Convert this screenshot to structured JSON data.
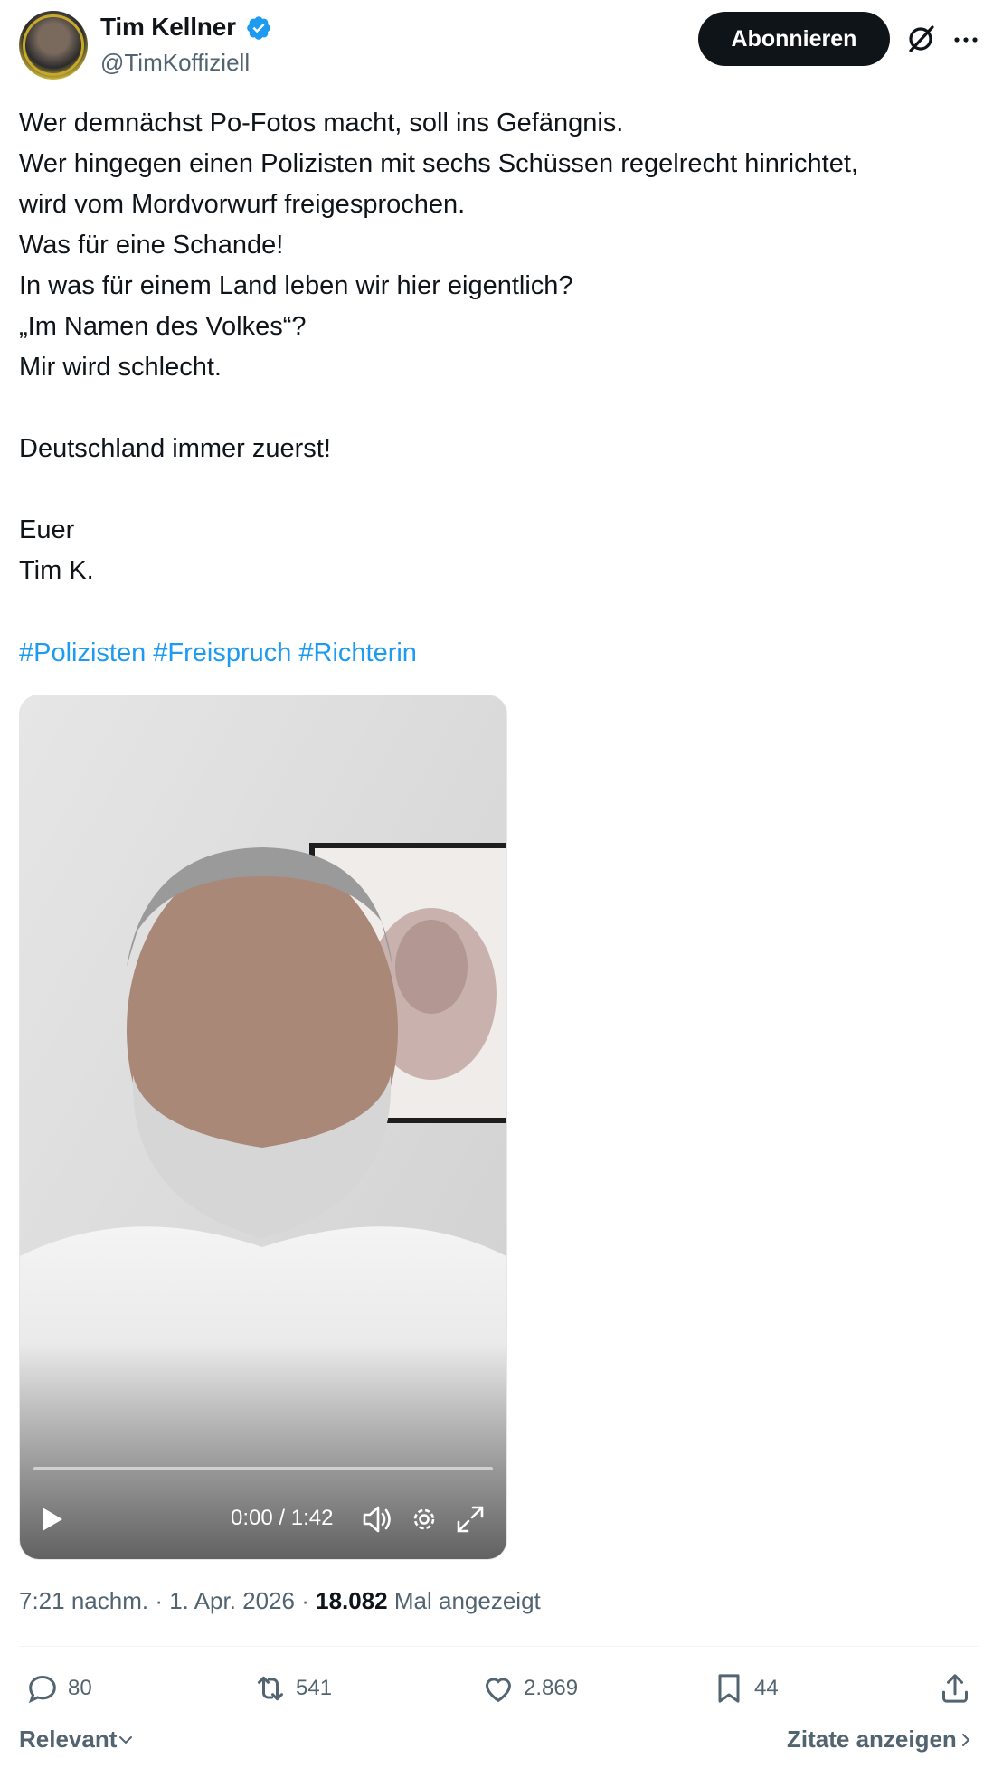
{
  "author": {
    "display_name": "Tim Kellner",
    "handle": "@TimKoffiziell",
    "verified": true
  },
  "header": {
    "follow_label": "Abonnieren",
    "icons": [
      "grok-icon",
      "more-icon"
    ]
  },
  "tweet": {
    "text": "Wer demnächst Po-Fotos macht, soll ins Gefängnis.\nWer hingegen einen Polizisten mit sechs Schüssen regelrecht hinrichtet,\nwird vom Mordvorwurf freigesprochen.\nWas für eine Schande!\nIn was für einem Land leben wir hier eigentlich?\n„Im Namen des Volkes“?\nMir wird schlecht.\n\nDeutschland immer zuerst!\n\nEuer\nTim K.",
    "hashtags": [
      "#Polizisten",
      "#Freispruch",
      "#Richterin"
    ]
  },
  "video": {
    "time_readout": "0:00 / 1:42",
    "progress": 0.0,
    "icons": [
      "play-icon",
      "volume-icon",
      "settings-icon",
      "fullscreen-icon"
    ]
  },
  "meta": {
    "time": "7:21 nachm.",
    "separator": " · ",
    "date": "1. Apr. 2026",
    "views_count": "18.082",
    "views_label": "Mal angezeigt"
  },
  "actions": {
    "reply_count": "80",
    "retweet_count": "541",
    "like_count": "2.869",
    "bookmark_count": "44"
  },
  "footer": {
    "sort_label": "Relevant",
    "quotes_label": "Zitate anzeigen"
  },
  "colors": {
    "accent": "#1d9bf0",
    "text": "#0f1419",
    "secondary": "#536471",
    "button_bg": "#0f1419"
  }
}
